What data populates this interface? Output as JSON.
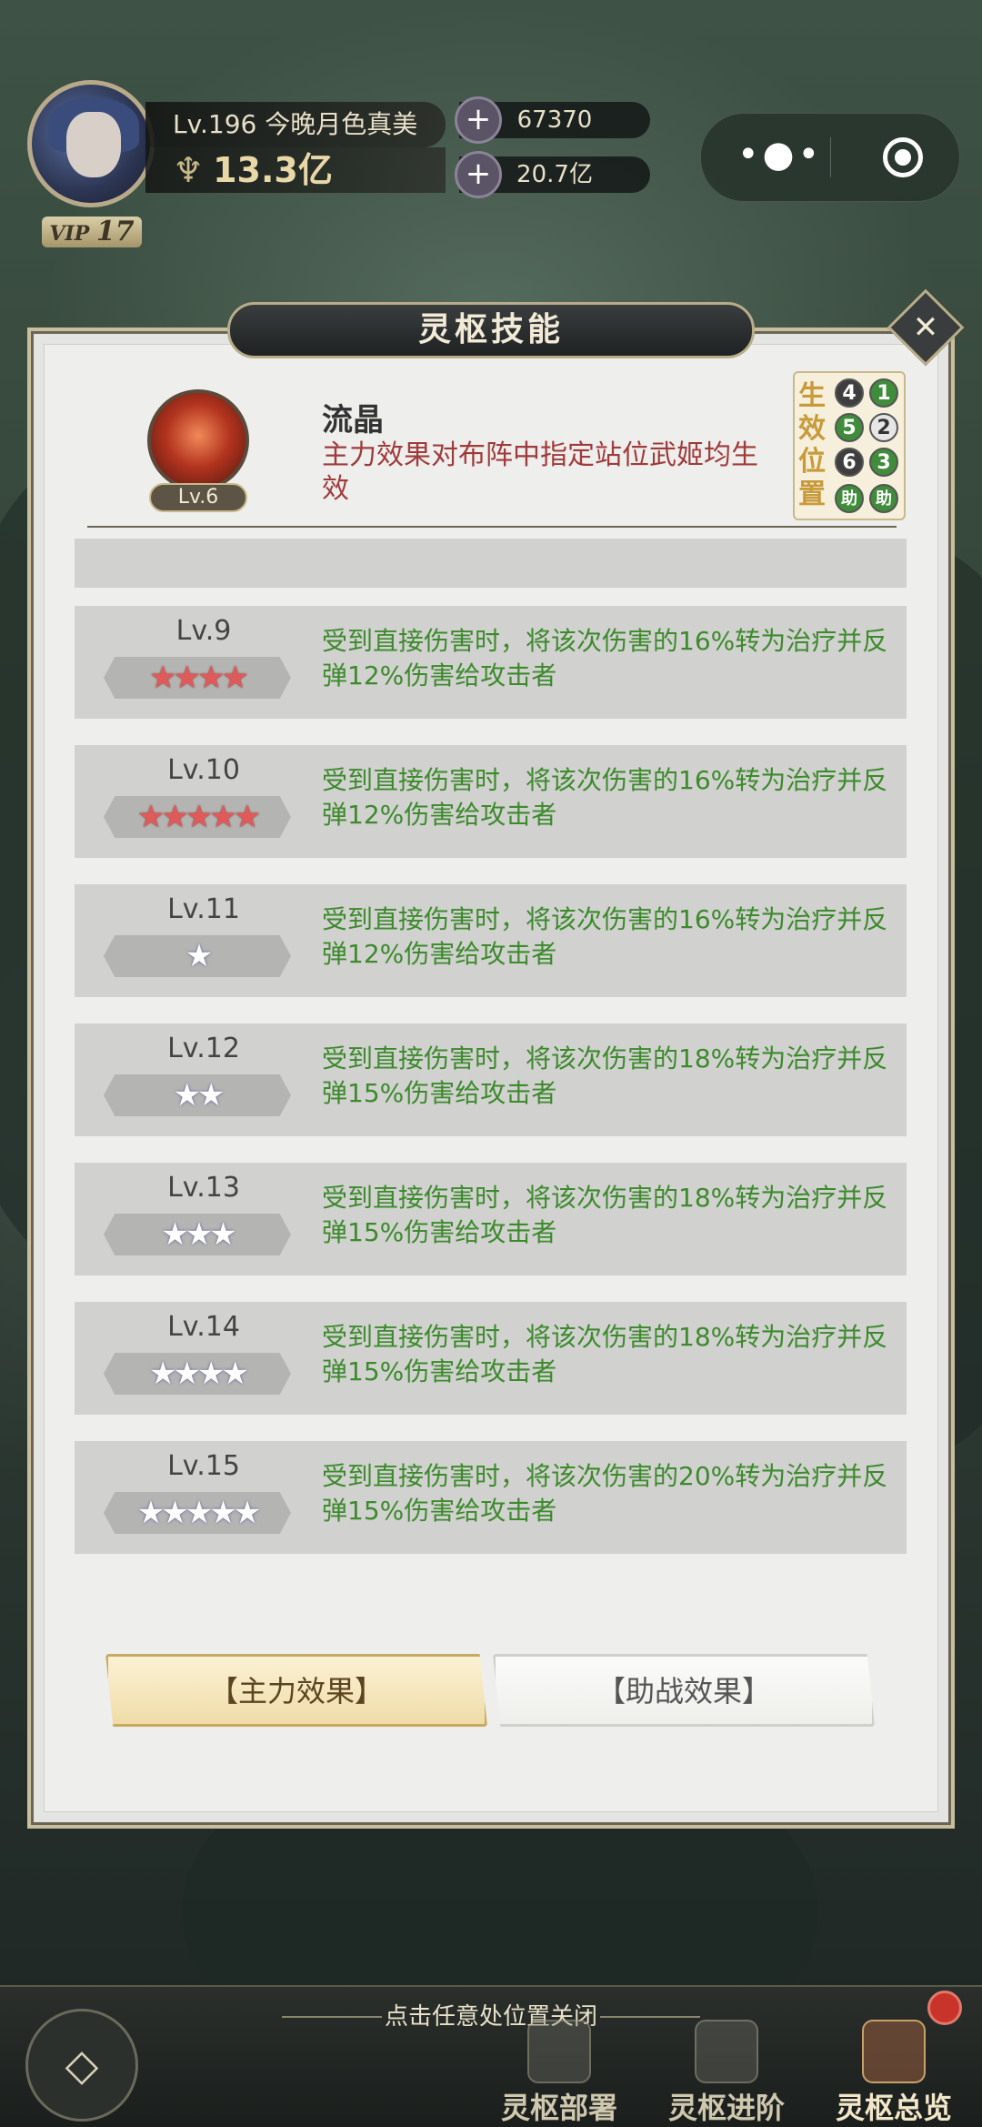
{
  "player": {
    "level_name": "Lv.196 今晚月色真美",
    "power": "13.3亿",
    "vip_prefix": "VIP",
    "vip_level": "17"
  },
  "resources": {
    "gems": "67370",
    "coins": "20.7亿"
  },
  "dialog": {
    "title": "灵枢技能",
    "close_icon": "close-icon"
  },
  "skill": {
    "level": "Lv.6",
    "name": "流晶",
    "description": "主力效果对布阵中指定站位武姬均生效"
  },
  "positions": {
    "label_chars": [
      "生",
      "效",
      "位",
      "置"
    ],
    "dots": [
      "4",
      "1",
      "5",
      "2",
      "6",
      "3",
      "助",
      "助"
    ]
  },
  "levels": [
    {
      "lv": "Lv.9",
      "stars": "★★★★",
      "star_color": "red",
      "desc": "受到直接伤害时，将该次伤害的16%转为治疗并反弹12%伤害给攻击者"
    },
    {
      "lv": "Lv.10",
      "stars": "★★★★★",
      "star_color": "red",
      "desc": "受到直接伤害时，将该次伤害的16%转为治疗并反弹12%伤害给攻击者"
    },
    {
      "lv": "Lv.11",
      "stars": "★",
      "star_color": "white",
      "desc": "受到直接伤害时，将该次伤害的16%转为治疗并反弹12%伤害给攻击者"
    },
    {
      "lv": "Lv.12",
      "stars": "★★",
      "star_color": "white",
      "desc": "受到直接伤害时，将该次伤害的18%转为治疗并反弹15%伤害给攻击者"
    },
    {
      "lv": "Lv.13",
      "stars": "★★★",
      "star_color": "white",
      "desc": "受到直接伤害时，将该次伤害的18%转为治疗并反弹15%伤害给攻击者"
    },
    {
      "lv": "Lv.14",
      "stars": "★★★★",
      "star_color": "white",
      "desc": "受到直接伤害时，将该次伤害的18%转为治疗并反弹15%伤害给攻击者"
    },
    {
      "lv": "Lv.15",
      "stars": "★★★★★",
      "star_color": "white",
      "desc": "受到直接伤害时，将该次伤害的20%转为治疗并反弹15%伤害给攻击者"
    }
  ],
  "tabs": {
    "main": "【主力效果】",
    "assist": "【助战效果】"
  },
  "hint": "点击任意处位置关闭",
  "nav": {
    "deploy": "灵枢部署",
    "advance": "灵枢进阶",
    "overview": "灵枢总览"
  }
}
